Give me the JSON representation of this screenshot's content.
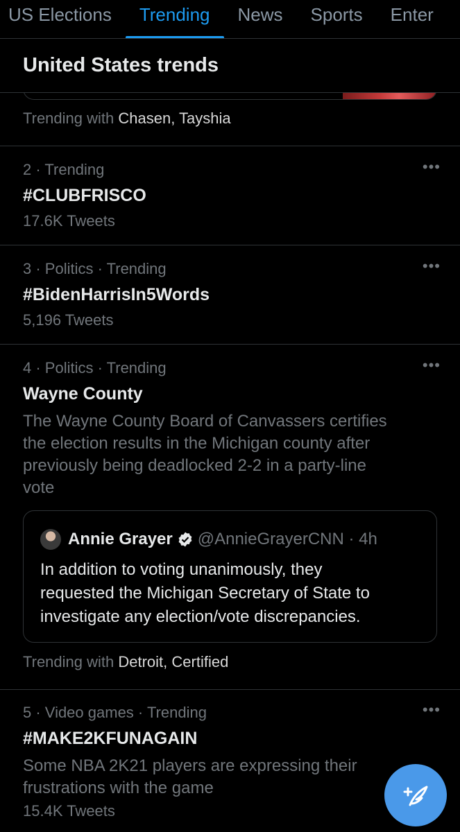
{
  "tabs": [
    {
      "label": "US Elections"
    },
    {
      "label": "Trending"
    },
    {
      "label": "News"
    },
    {
      "label": "Sports"
    },
    {
      "label": "Enter"
    }
  ],
  "header": {
    "title": "United States trends"
  },
  "trend1": {
    "trending_with_prefix": "Trending with",
    "trending_with_names": "Chasen, Tayshia"
  },
  "trend2": {
    "meta": "2 · Trending",
    "title": "#CLUBFRISCO",
    "count": "17.6K Tweets"
  },
  "trend3": {
    "meta": "3 · Politics · Trending",
    "title": "#BidenHarrisIn5Words",
    "count": "5,196 Tweets"
  },
  "trend4": {
    "meta": "4 · Politics · Trending",
    "title": "Wayne County",
    "description_lines": [
      "The Wayne County Board of Canvassers certifies",
      "the election results in the Michigan county after",
      "previously being deadlocked 2-2 in a party-line",
      "vote"
    ],
    "tweet": {
      "name": "Annie Grayer",
      "handle": "@AnnieGrayerCNN · 4h",
      "body_lines": [
        "In addition to voting unanimously, they",
        "requested the Michigan Secretary of State to",
        "investigate any election/vote discrepancies."
      ]
    },
    "trending_with_prefix": "Trending with",
    "trending_with_names": "Detroit, Certified"
  },
  "trend5": {
    "meta": "5 · Video games · Trending",
    "title": "#MAKE2KFUNAGAIN",
    "description_lines": [
      "Some NBA 2K21 players are expressing their",
      "frustrations with the game"
    ],
    "count": "15.4K Tweets"
  },
  "more_label": "•••",
  "colors": {
    "accent": "#1d9bf0",
    "fab": "#4a99e9",
    "background": "#000000",
    "muted": "#71767b"
  },
  "icons": {
    "verified": "verified-badge-icon",
    "compose": "compose-tweet-icon",
    "more": "more-dots-icon"
  }
}
